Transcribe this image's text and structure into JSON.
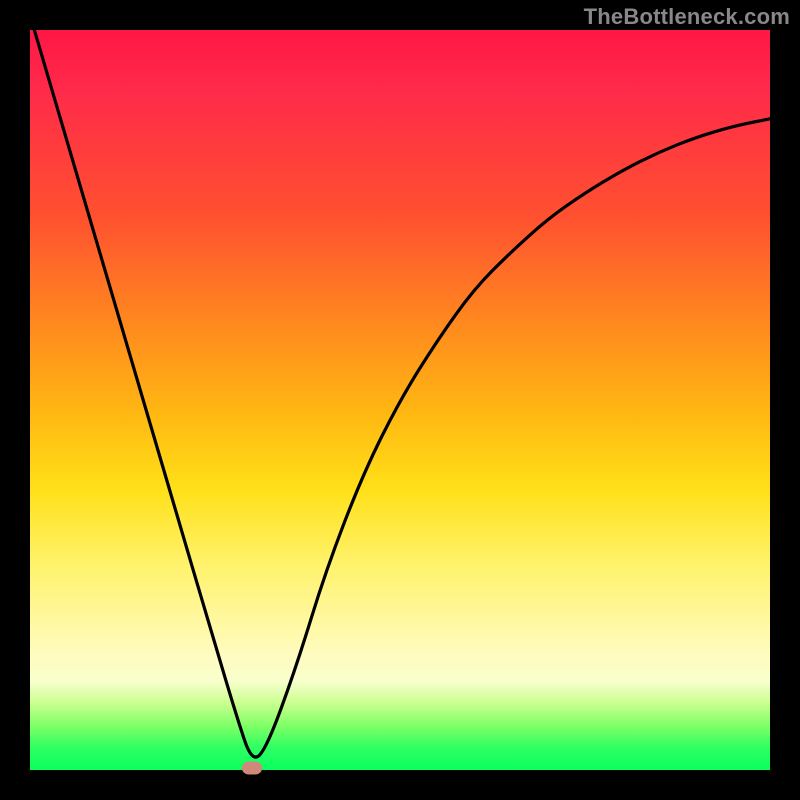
{
  "watermark": "TheBottleneck.com",
  "chart_data": {
    "type": "line",
    "title": "",
    "xlabel": "",
    "ylabel": "",
    "xlim": [
      0,
      100
    ],
    "ylim": [
      0,
      100
    ],
    "grid": false,
    "legend": false,
    "series": [
      {
        "name": "bottleneck-curve",
        "x": [
          0,
          5,
          10,
          15,
          20,
          25,
          28,
          30,
          32,
          36,
          40,
          45,
          50,
          55,
          60,
          65,
          70,
          75,
          80,
          85,
          90,
          95,
          100
        ],
        "y": [
          102,
          85,
          68,
          51,
          34,
          17,
          7,
          1,
          3,
          14,
          27,
          40,
          50,
          58,
          65,
          70,
          74.5,
          78,
          81,
          83.5,
          85.5,
          87,
          88
        ]
      }
    ],
    "marker": {
      "x": 30,
      "y": 0.3
    },
    "gradient_stops": [
      {
        "pos": 0,
        "color": "#ff1744"
      },
      {
        "pos": 25,
        "color": "#ff5030"
      },
      {
        "pos": 52,
        "color": "#ffb812"
      },
      {
        "pos": 72,
        "color": "#fff26a"
      },
      {
        "pos": 91,
        "color": "#c9ff8f"
      },
      {
        "pos": 100,
        "color": "#0aff5e"
      }
    ]
  },
  "colors": {
    "frame": "#000000",
    "curve": "#000000",
    "marker": "#d08878",
    "watermark": "#888888"
  }
}
